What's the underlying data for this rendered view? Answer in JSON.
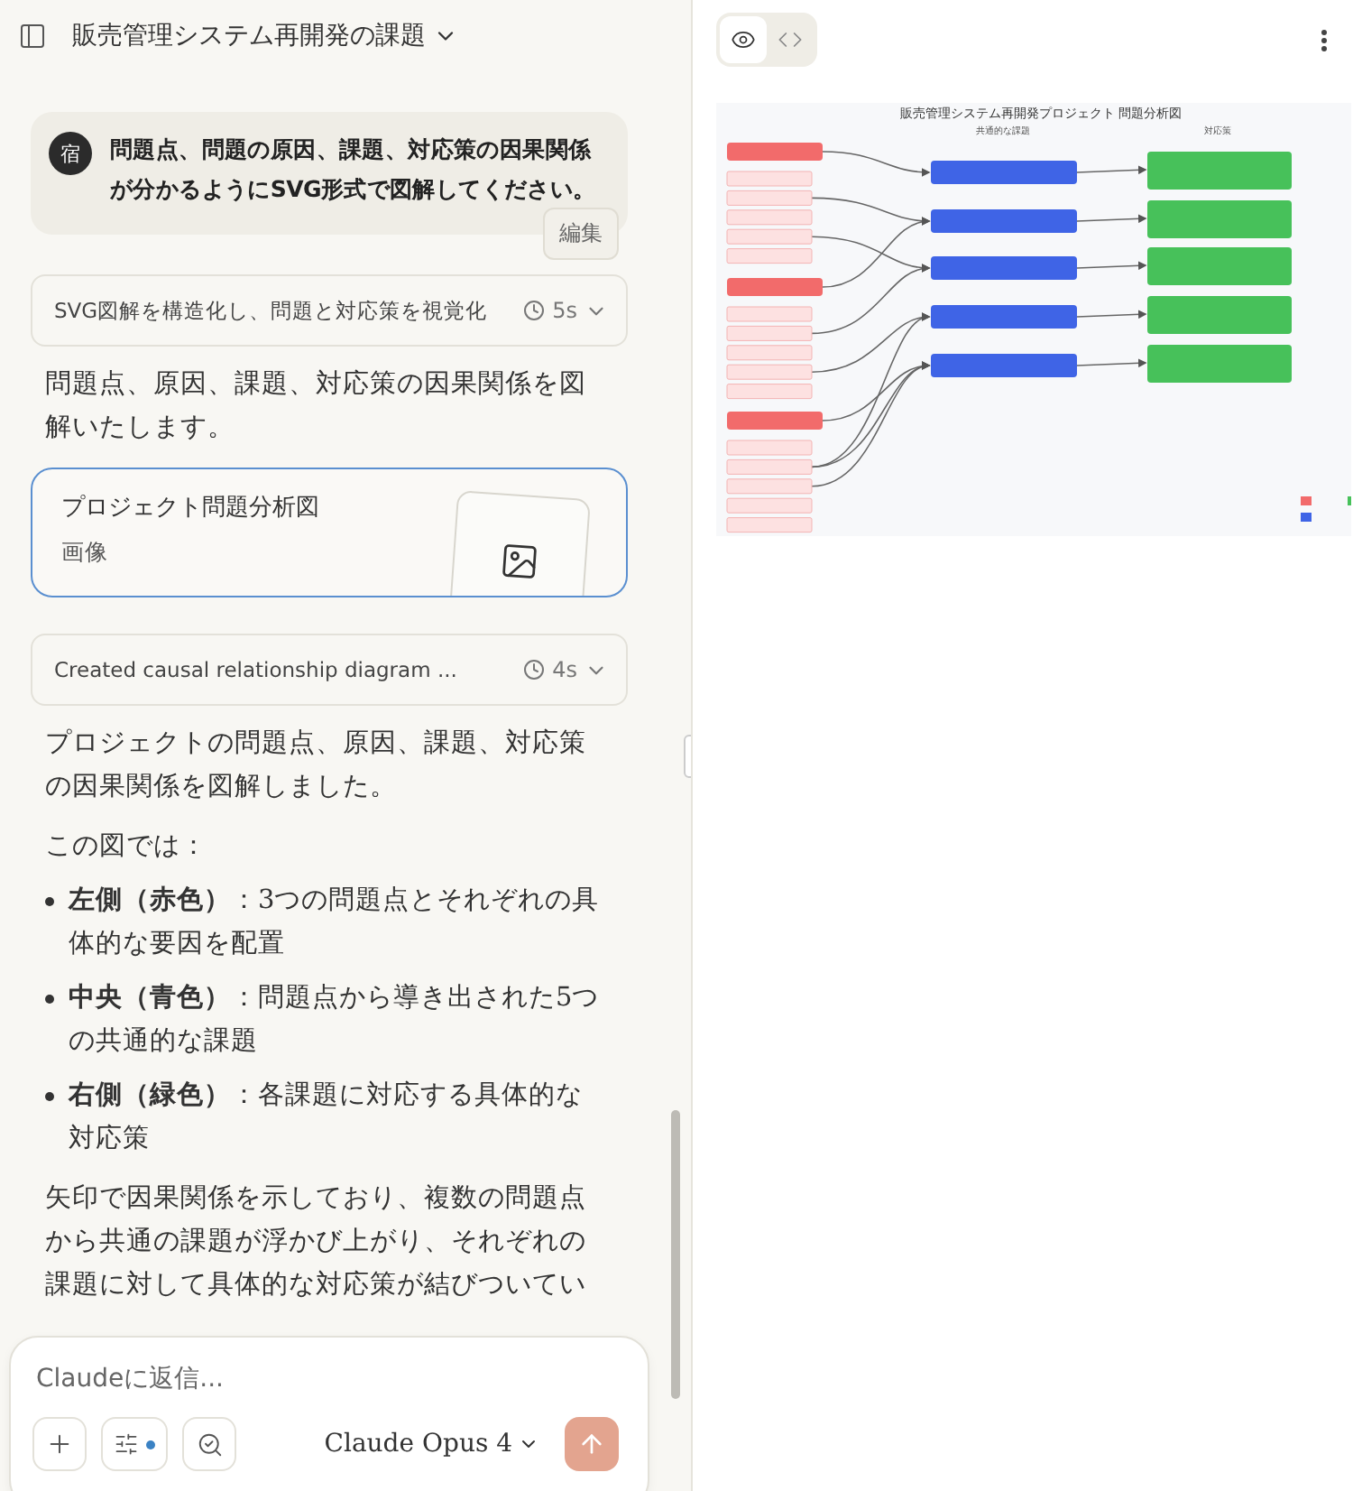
{
  "header": {
    "title": "販売管理システム再開発の課題"
  },
  "user_message": {
    "avatar": "宿",
    "text": "問題点、問題の原因、課題、対応策の因果関係が分かるようにSVG形式で図解してください。",
    "edit_label": "編集"
  },
  "response": [
    {
      "kind": "thinking",
      "text": "SVG図解を構造化し、問題と対応策を視覚化",
      "duration": "5s"
    },
    {
      "kind": "paragraph",
      "text": "問題点、原因、課題、対応策の因果関係を図解いたします。"
    },
    {
      "kind": "artifact",
      "title": "プロジェクト問題分析図",
      "subtitle": "画像"
    },
    {
      "kind": "thinking",
      "text": "Created causal relationship diagram ...",
      "duration": "4s"
    },
    {
      "kind": "paragraph",
      "text": "プロジェクトの問題点、原因、課題、対応策の因果関係を図解しました。"
    },
    {
      "kind": "paragraph",
      "text": "この図では："
    },
    {
      "kind": "bullets",
      "items": [
        "**左側（赤色）**：3つの問題点とそれぞれの具体的な要因を配置",
        "**中央（青色）**：問題点から導き出された5つの共通的な課題",
        "**右側（緑色）**：各課題に対応する具体的な対応策"
      ]
    },
    {
      "kind": "paragraph",
      "text": "矢印で因果関係を示しており、複数の問題点から共通の課題が浮かび上がり、それぞれの課題に対して具体的な対応策が結びついてい"
    }
  ],
  "composer": {
    "placeholder": "Claudeに返信...",
    "model": "Claude Opus 4"
  },
  "preview": {
    "view_tabs": [
      {
        "kind": "preview",
        "selected": true
      },
      {
        "kind": "code",
        "selected": false
      }
    ],
    "diagram": {
      "title": "販売管理システム再開発プロジェクト 問題分析図",
      "column_headers": [
        "共通的な課題",
        "対応策"
      ]
    }
  }
}
